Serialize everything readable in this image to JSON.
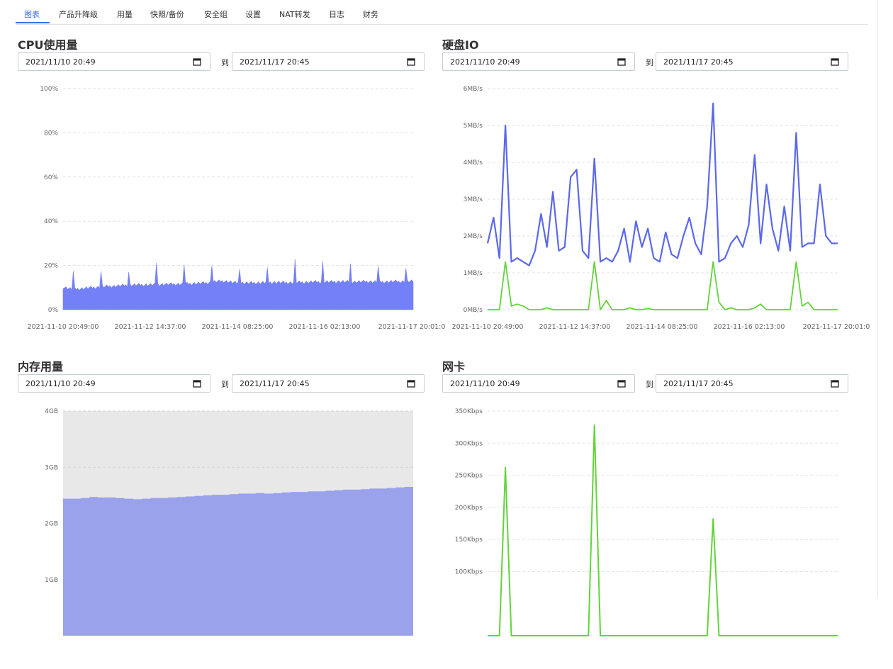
{
  "tabs": [
    {
      "label": "图表",
      "active": true
    },
    {
      "label": "产品升降级"
    },
    {
      "label": "用量"
    },
    {
      "label": "快照/备份"
    },
    {
      "label": "安全组"
    },
    {
      "label": "设置"
    },
    {
      "label": "NAT转发"
    },
    {
      "label": "日志"
    },
    {
      "label": "财务"
    }
  ],
  "date_separator": "到",
  "colors": {
    "accent": "#3a6ee8",
    "cpu_fill": "#7480f7",
    "io_line": "#5b68ea",
    "io_green": "#62d43a",
    "mem_fill": "#9aa2ec",
    "mem_bg": "#e8e8e8",
    "net_green": "#62d43a"
  },
  "panels": {
    "cpu": {
      "title": "CPU使用量",
      "from": "2021/11/10 20:49",
      "to": "2021/11/17 20:45"
    },
    "disk": {
      "title": "硬盘IO",
      "from": "2021/11/10 20:49",
      "to": "2021/11/17 20:45"
    },
    "memory": {
      "title": "内存用量",
      "from": "2021/11/10 20:49",
      "to": "2021/11/17 20:45"
    },
    "network": {
      "title": "网卡",
      "from": "2021/11/10 20:49",
      "to": "2021/11/17 20:45"
    }
  },
  "chart_data": [
    {
      "id": "cpu",
      "type": "area",
      "title": "",
      "ylim": [
        0,
        100
      ],
      "yticks": [
        "0%",
        "20%",
        "40%",
        "60%",
        "80%",
        "100%"
      ],
      "xticks": [
        "2021-11-10 20:49:00",
        "2021-11-12 14:37:00",
        "2021-11-14 08:25:00",
        "2021-11-16 02:13:00",
        "2021-11-17 20:01:0"
      ],
      "grid": true,
      "series": [
        {
          "values": [
            9.5,
            8.5,
            8.8,
            9.2,
            9.5,
            9.8,
            10,
            10.3,
            10.5,
            10.5,
            10.6,
            10.7,
            10.8,
            10.9,
            11,
            11.2,
            11.4,
            12,
            12.2,
            11.5,
            11.3,
            11.4,
            11.5,
            11.6,
            11.6,
            11.5,
            11.6,
            11.7,
            11.8,
            11.8,
            11.9,
            12,
            11.8,
            11.9,
            12,
            11.8,
            11.9,
            12,
            12,
            12.1
          ]
        }
      ]
    },
    {
      "id": "disk",
      "type": "line",
      "title": "",
      "ylim": [
        0,
        6
      ],
      "yticks": [
        "0MB/s",
        "1MB/s",
        "2MB/s",
        "3MB/s",
        "4MB/s",
        "5MB/s",
        "6MB/s"
      ],
      "xticks": [
        "2021-11-10 20:49:00",
        "2021-11-12 14:37:00",
        "2021-11-14 08:25:00",
        "2021-11-16 02:13:00",
        "2021-11-17 20:01:0"
      ],
      "grid": true,
      "series": [
        {
          "values": [
            1.8,
            2.5,
            1.4,
            5.0,
            1.3,
            1.4,
            1.3,
            1.2,
            1.6,
            2.6,
            1.7,
            3.2,
            1.6,
            1.7,
            3.6,
            3.8,
            1.6,
            1.4,
            4.1,
            1.3,
            1.4,
            1.3,
            1.6,
            2.2,
            1.3,
            2.4,
            1.7,
            2.2,
            1.4,
            1.3,
            2.1,
            1.5,
            1.4,
            2.0,
            2.5,
            1.8,
            1.5,
            2.8,
            5.6,
            1.3,
            1.4,
            1.8,
            2.0,
            1.7,
            2.3,
            4.2,
            1.8,
            3.4,
            2.2,
            1.6,
            2.8,
            1.6,
            4.8,
            1.7,
            1.8,
            1.8,
            3.4,
            2.0,
            1.8,
            1.8
          ]
        },
        {
          "values": [
            0,
            0,
            0,
            1.3,
            0.1,
            0.15,
            0.1,
            0,
            0,
            0,
            0.05,
            0,
            0,
            0,
            0,
            0,
            0,
            0,
            1.3,
            0,
            0.25,
            0,
            0,
            0,
            0.05,
            0,
            0,
            0.03,
            0,
            0,
            0,
            0,
            0,
            0,
            0,
            0,
            0,
            0,
            1.3,
            0.2,
            0,
            0.05,
            0,
            0,
            0,
            0.05,
            0.15,
            0,
            0,
            0,
            0,
            0,
            1.3,
            0.1,
            0.2,
            0,
            0,
            0,
            0,
            0
          ]
        }
      ]
    },
    {
      "id": "memory",
      "type": "area",
      "title": "",
      "ylim": [
        0,
        4
      ],
      "yticks": [
        "1GB",
        "2GB",
        "3GB",
        "4GB"
      ],
      "xticks": [],
      "grid": true,
      "series": [
        {
          "values": [
            2.44,
            2.44,
            2.45,
            2.47,
            2.46,
            2.46,
            2.45,
            2.44,
            2.43,
            2.44,
            2.45,
            2.45,
            2.46,
            2.47,
            2.48,
            2.49,
            2.5,
            2.51,
            2.51,
            2.52,
            2.53,
            2.53,
            2.54,
            2.53,
            2.54,
            2.55,
            2.56,
            2.56,
            2.57,
            2.57,
            2.58,
            2.59,
            2.6,
            2.6,
            2.61,
            2.62,
            2.62,
            2.63,
            2.64,
            2.65
          ]
        }
      ]
    },
    {
      "id": "network",
      "type": "line",
      "title": "",
      "ylim": [
        0,
        350
      ],
      "yticks": [
        "100Kbps",
        "150Kbps",
        "200Kbps",
        "250Kbps",
        "300Kbps",
        "350Kbps"
      ],
      "xticks": [],
      "grid": true,
      "series": [
        {
          "values": [
            0,
            0,
            0,
            262,
            0,
            0,
            0,
            0,
            0,
            0,
            0,
            0,
            0,
            0,
            0,
            0,
            0,
            0,
            328,
            0,
            0,
            0,
            0,
            0,
            0,
            0,
            0,
            0,
            0,
            0,
            0,
            0,
            0,
            0,
            0,
            0,
            0,
            0,
            182,
            0,
            0,
            0,
            0,
            0,
            0,
            0,
            0,
            0,
            0,
            0,
            0,
            0,
            0,
            0,
            0,
            0,
            0,
            0,
            0,
            0
          ]
        }
      ]
    }
  ]
}
